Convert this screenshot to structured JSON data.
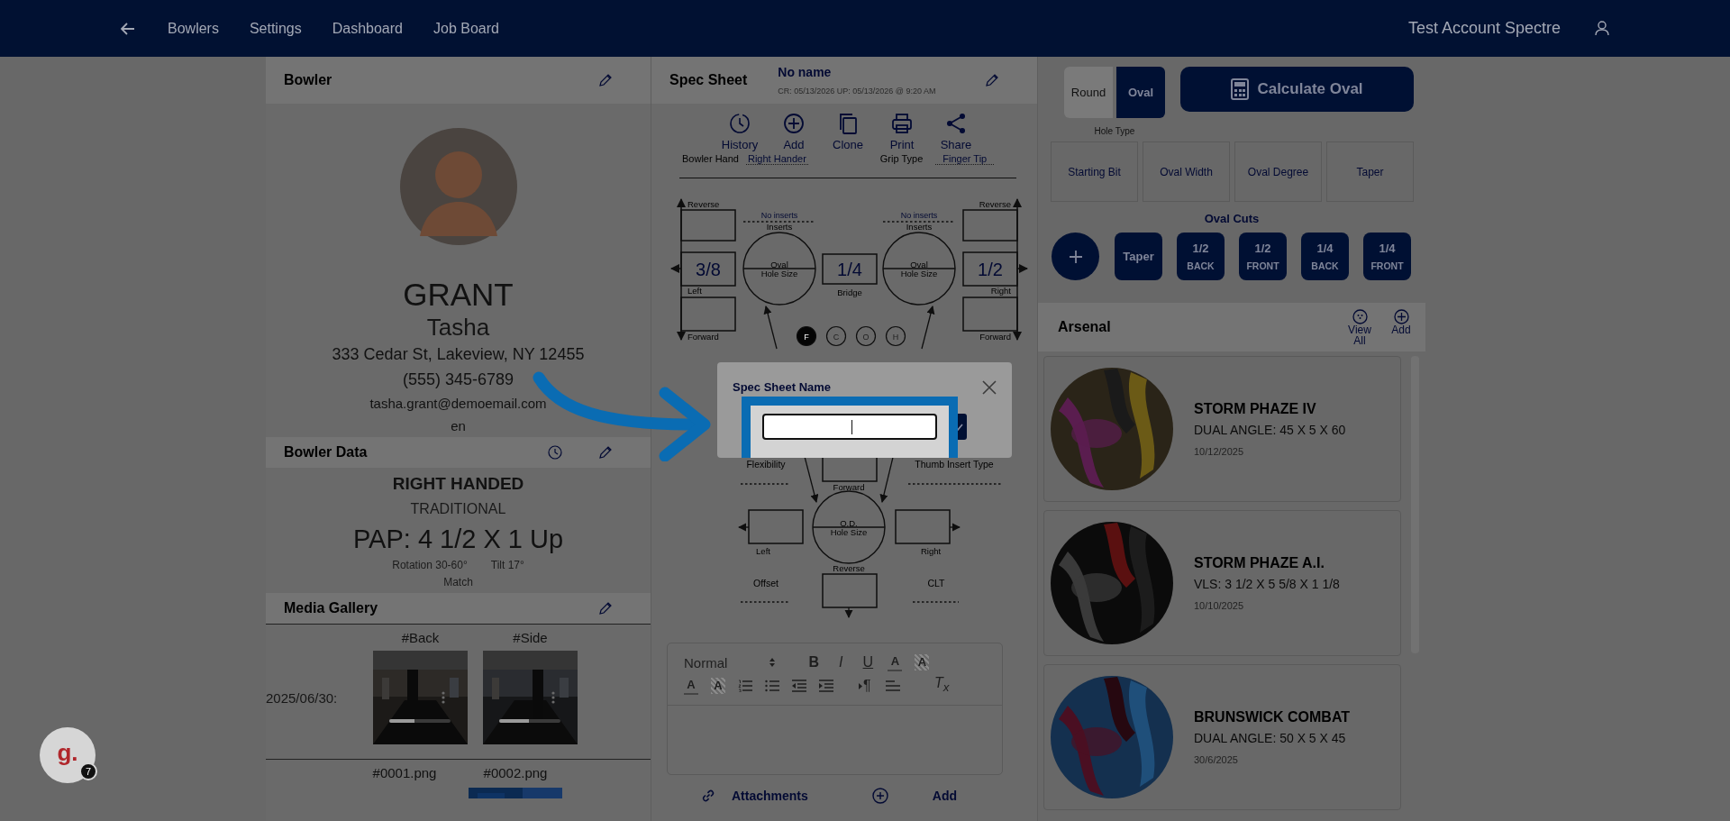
{
  "nav": {
    "items": [
      {
        "label": "Bowlers"
      },
      {
        "label": "Settings"
      },
      {
        "label": "Dashboard"
      },
      {
        "label": "Job Board"
      }
    ],
    "account": "Test Account Spectre"
  },
  "bowler": {
    "title": "Bowler",
    "last_name": "GRANT",
    "first_name": "Tasha",
    "address": "333 Cedar St, Lakeview, NY 12455",
    "phone": "(555) 345-6789",
    "email": "tasha.grant@demoemail.com",
    "language": "en"
  },
  "bowler_data": {
    "title": "Bowler Data",
    "hand": "RIGHT HANDED",
    "style": "TRADITIONAL",
    "pap": "PAP: 4 1/2 X 1 Up",
    "rotation": "Rotation 30-60°",
    "tilt": "Tilt 17°",
    "match": "Match"
  },
  "media_gallery": {
    "title": "Media Gallery",
    "date": "2025/06/30:",
    "videos": [
      {
        "tag": "#Back",
        "level": 0.41
      },
      {
        "tag": "#Side",
        "level": 0.48
      }
    ],
    "files": [
      {
        "name": "#0001.png"
      },
      {
        "name": "#0002.png",
        "kind": "picture"
      }
    ]
  },
  "spec_sheet": {
    "title": "Spec Sheet",
    "name": "No name",
    "timestamps": "CR: 05/13/2026 UP: 05/13/2026 @ 9:20 AM",
    "actions": [
      {
        "kind": "history",
        "label": "History"
      },
      {
        "kind": "add",
        "label": "Add"
      },
      {
        "kind": "clone",
        "label": "Clone"
      },
      {
        "kind": "print",
        "label": "Print"
      },
      {
        "kind": "share",
        "label": "Share"
      }
    ],
    "bowler_hand_label": "Bowler Hand",
    "bowler_hand": "Right Hander",
    "grip_type_label": "Grip Type",
    "grip_type": "Finger Tip",
    "diagram": {
      "left_finger": {
        "reverse": "Reverse",
        "pitch": "3/8",
        "side": "Left",
        "forward": "Forward",
        "inserts": "No inserts",
        "inserts_label": "Inserts",
        "hole": "Oval",
        "hole_size": "Hole Size"
      },
      "bridge": {
        "value": "1/4",
        "label": "Bridge"
      },
      "right_finger": {
        "reverse": "Reverse",
        "pitch": "1/2",
        "side": "Right",
        "forward": "Forward",
        "inserts": "No inserts",
        "inserts_label": "Inserts",
        "hole": "Oval",
        "hole_size": "Hole Size"
      },
      "fit_options": [
        {
          "label": "F",
          "selected": true
        },
        {
          "label": "C",
          "selected": false
        },
        {
          "label": "O",
          "selected": false
        },
        {
          "label": "H",
          "selected": false
        }
      ],
      "thumb": {
        "flexibility": "Flexibility",
        "insert_type": "Thumb Insert Type",
        "forward": "Forward",
        "hole": "O.D.",
        "hole_size": "Hole Size",
        "left": "Left",
        "right": "Right",
        "reverse": "Reverse",
        "offset": "Offset",
        "clt": "CLT"
      }
    },
    "editor": {
      "format": "Normal",
      "row_1": [
        {
          "kind": "bold",
          "label": "B"
        },
        {
          "kind": "italic",
          "label": "I"
        },
        {
          "kind": "underline",
          "label": "U"
        },
        {
          "kind": "color",
          "label": "A"
        },
        {
          "kind": "background",
          "label": "A"
        }
      ],
      "row_2": [
        {
          "kind": "color",
          "label": "A"
        },
        {
          "kind": "background",
          "label": "A"
        },
        {
          "kind": "ordered"
        },
        {
          "kind": "bullet"
        },
        {
          "kind": "outdent"
        },
        {
          "kind": "indent"
        },
        {
          "kind": "direction",
          "label": "¶"
        },
        {
          "kind": "align"
        },
        {
          "kind": "clean",
          "label": "T$_{x}$"
        }
      ]
    },
    "attachments_label": "Attachments",
    "add_label": "Add"
  },
  "hole_type": {
    "label": "Hole Type",
    "options": [
      {
        "label": "Round",
        "selected": false
      },
      {
        "label": "Oval",
        "selected": true
      }
    ]
  },
  "calculate_button": "Calculate Oval",
  "oval_fields": [
    "Starting Bit",
    "Oval Width",
    "Oval Degree",
    "Taper"
  ],
  "oval_cuts": {
    "title": "Oval Cuts",
    "items": [
      {
        "top": "Taper"
      },
      {
        "top": "1/2",
        "bottom": "BACK"
      },
      {
        "top": "1/2",
        "bottom": "FRONT"
      },
      {
        "top": "1/4",
        "bottom": "BACK"
      },
      {
        "top": "1/4",
        "bottom": "FRONT"
      }
    ]
  },
  "arsenal": {
    "title": "Arsenal",
    "view_all": "View All",
    "add": "Add",
    "balls": [
      {
        "name": "STORM PHAZE IV",
        "layout": "DUAL ANGLE: 45 X 5 X 60",
        "date": "10/12/2025",
        "kind": "picture"
      },
      {
        "name": "STORM PHAZE A.I.",
        "layout": "VLS: 3 1/2 X 5 5/8 X 1 1/8",
        "date": "10/10/2025",
        "kind": "picture"
      },
      {
        "name": "BRUNSWICK COMBAT",
        "layout": "DUAL ANGLE: 50 X 5 X 45",
        "date": "30/6/2025",
        "kind": "picture"
      }
    ]
  },
  "modal": {
    "title": "Spec Sheet Name"
  },
  "help_badge": {
    "label": "g.",
    "count": "7"
  }
}
